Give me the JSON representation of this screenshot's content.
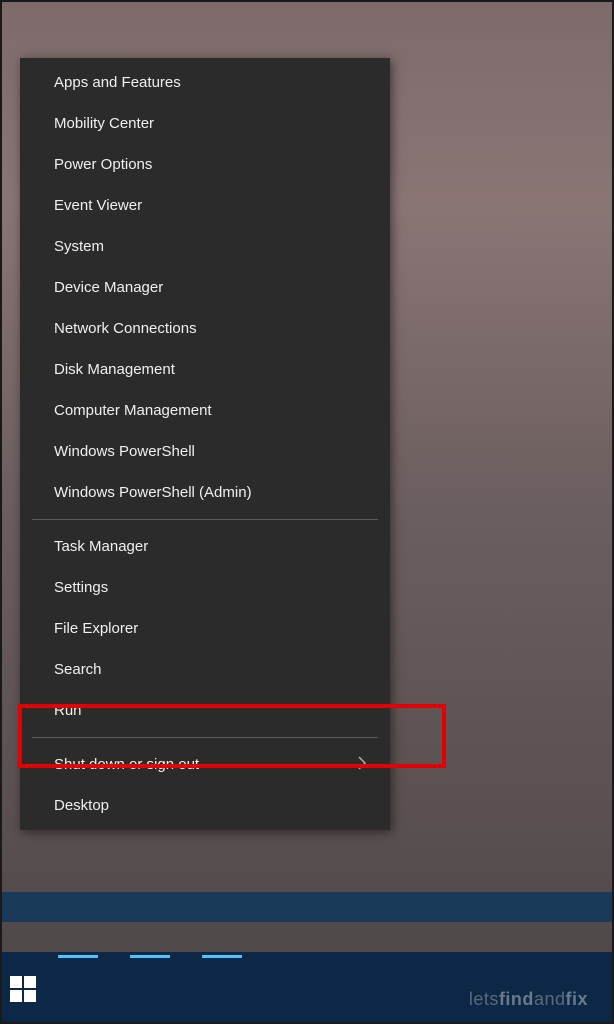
{
  "menu": {
    "group1": [
      {
        "label": "Apps and Features",
        "name": "menu-apps-features"
      },
      {
        "label": "Mobility Center",
        "name": "menu-mobility-center"
      },
      {
        "label": "Power Options",
        "name": "menu-power-options"
      },
      {
        "label": "Event Viewer",
        "name": "menu-event-viewer"
      },
      {
        "label": "System",
        "name": "menu-system"
      },
      {
        "label": "Device Manager",
        "name": "menu-device-manager"
      },
      {
        "label": "Network Connections",
        "name": "menu-network-connections"
      },
      {
        "label": "Disk Management",
        "name": "menu-disk-management"
      },
      {
        "label": "Computer Management",
        "name": "menu-computer-management"
      },
      {
        "label": "Windows PowerShell",
        "name": "menu-powershell"
      },
      {
        "label": "Windows PowerShell (Admin)",
        "name": "menu-powershell-admin"
      }
    ],
    "group2": [
      {
        "label": "Task Manager",
        "name": "menu-task-manager"
      },
      {
        "label": "Settings",
        "name": "menu-settings"
      },
      {
        "label": "File Explorer",
        "name": "menu-file-explorer"
      },
      {
        "label": "Search",
        "name": "menu-search"
      },
      {
        "label": "Run",
        "name": "menu-run"
      }
    ],
    "group3": [
      {
        "label": "Shut down or sign out",
        "name": "menu-shutdown",
        "submenu": true
      },
      {
        "label": "Desktop",
        "name": "menu-desktop"
      }
    ]
  },
  "watermark": {
    "part1": "lets",
    "part2": "find",
    "part3": "and",
    "part4": "fix"
  },
  "highlighted_item": "Search"
}
